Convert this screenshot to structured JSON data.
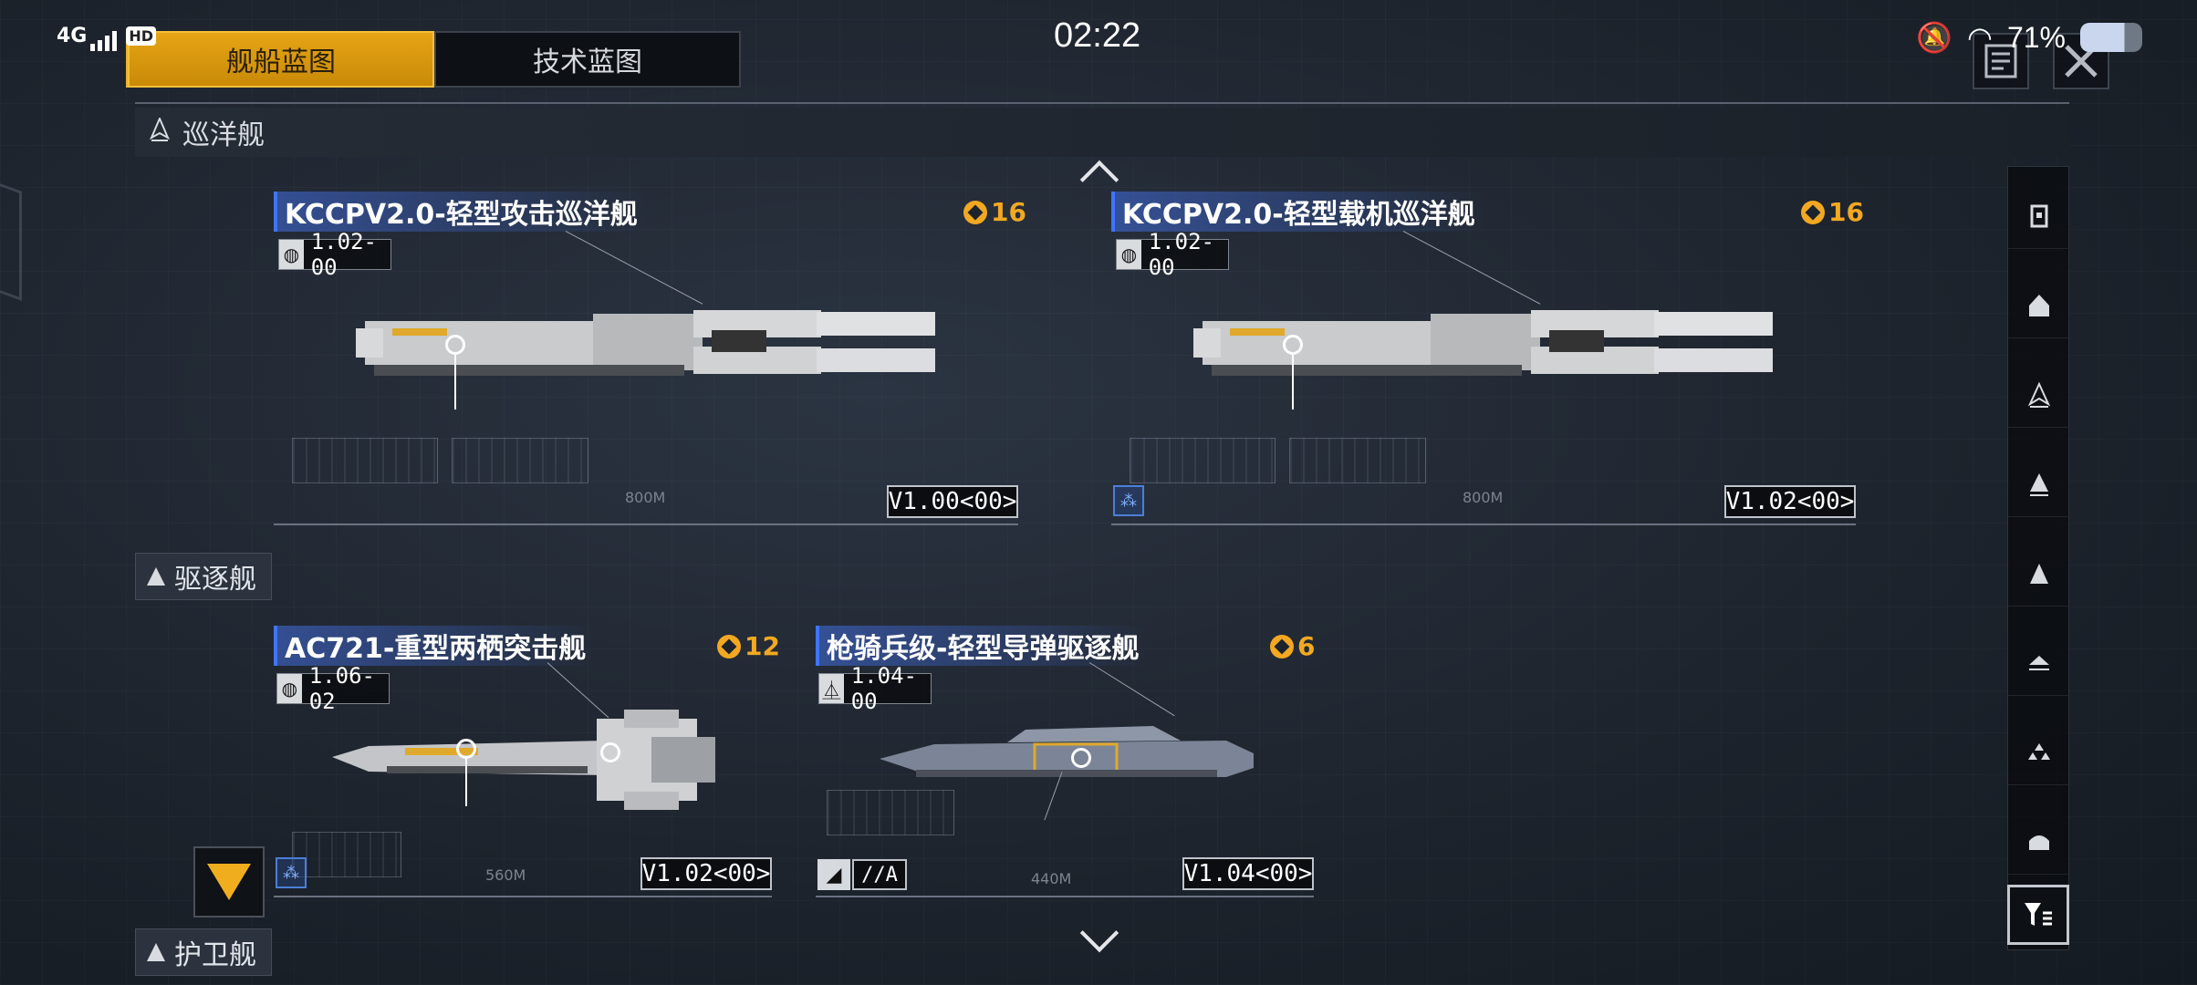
{
  "status_bar": {
    "network": "4G",
    "hd": "HD",
    "time": "02:22",
    "battery": "71%"
  },
  "tabs": [
    {
      "label": "舰船蓝图",
      "active": true
    },
    {
      "label": "技术蓝图",
      "active": false
    }
  ],
  "top_icons": [
    "notes-icon",
    "close-icon"
  ],
  "sections": {
    "cruiser": "巡洋舰",
    "destroyer": "驱逐舰",
    "frigate": "护卫舰"
  },
  "cards": [
    {
      "name": "KCCPV2.0-轻型攻击巡洋舰",
      "cost": "16",
      "version": "1.02-00",
      "tag": "V1.00<00>",
      "length": "800M"
    },
    {
      "name": "KCCPV2.0-轻型载机巡洋舰",
      "cost": "16",
      "version": "1.02-00",
      "tag": "V1.02<00>",
      "length": "800M"
    },
    {
      "name": "AC721-重型两栖突击舰",
      "cost": "12",
      "version": "1.06-02",
      "tag": "V1.02<00>",
      "length": "560M"
    },
    {
      "name": "枪骑兵级-轻型导弹驱逐舰",
      "cost": "6",
      "version": "1.04-00",
      "tag": "V1.04<00>",
      "length": "440M",
      "hull_code": "//A"
    }
  ],
  "colors": {
    "accent": "#f0ae1f",
    "name_bar": "#3a5cb4",
    "background": "#1d232c"
  }
}
